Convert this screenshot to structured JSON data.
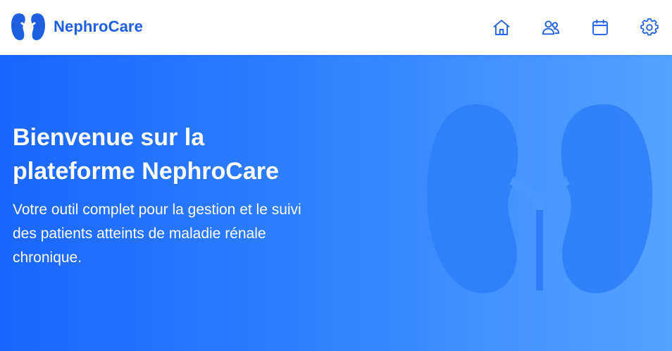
{
  "app": {
    "name": "NephroCare",
    "logo_icon": "kidney-icon"
  },
  "colors": {
    "brand": "#1d5fe0",
    "hero_gradient_start": "#1a66ff",
    "hero_gradient_end": "#54a2ff",
    "icon": "#1d5fe0"
  },
  "nav": {
    "items": [
      {
        "icon": "home-icon"
      },
      {
        "icon": "users-icon"
      },
      {
        "icon": "calendar-icon"
      },
      {
        "icon": "gear-icon"
      }
    ]
  },
  "hero": {
    "title_line1": "Bienvenue sur la",
    "title_line2": "plateforme NephroCare",
    "subtitle_line1": "Votre outil complet pour la gestion et le suivi",
    "subtitle_line2": "des patients atteints de maladie rénale",
    "subtitle_line3": "chronique.",
    "background_icon": "kidney-icon"
  }
}
